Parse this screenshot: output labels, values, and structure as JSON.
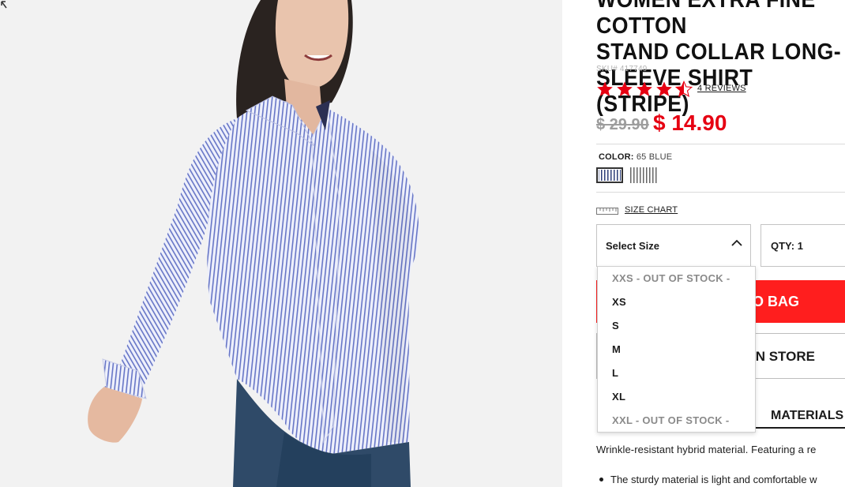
{
  "product": {
    "title": "WOMEN EXTRA FINE COTTON\nSTAND COLLAR LONG-\nSLEEVE SHIRT (STRIPE)",
    "sku": "SKU# 417749",
    "rating": 4.5,
    "rating_max": 5,
    "reviews_label": "4 REVIEWS",
    "old_price": "$ 29.90",
    "new_price": "$ 14.90",
    "color_label": "COLOR:",
    "color_value": "65 BLUE",
    "swatches": [
      "65 BLUE",
      "stripe-alt"
    ],
    "size_chart_label": "SIZE CHART",
    "select_size_label": "Select Size",
    "qty_label": "QTY: 1",
    "add_to_bag_label": "O BAG",
    "store_label": "IN STORE",
    "materials_tab_label": "MATERIALS",
    "description": "Wrinkle-resistant hybrid material. Featuring a re",
    "bullet_1": "The sturdy material is light and comfortable w"
  },
  "size_options": [
    {
      "label": "XXS - OUT OF STOCK -",
      "available": false
    },
    {
      "label": "XS",
      "available": true
    },
    {
      "label": "S",
      "available": true
    },
    {
      "label": "M",
      "available": true
    },
    {
      "label": "L",
      "available": true
    },
    {
      "label": "XL",
      "available": true
    },
    {
      "label": "XXL - OUT OF STOCK -",
      "available": false
    }
  ],
  "colors": {
    "accent_red": "#ff1e1e",
    "price_red": "#e60012",
    "star_red": "#e60012",
    "shirt_stripe": "#5a6fc4"
  }
}
